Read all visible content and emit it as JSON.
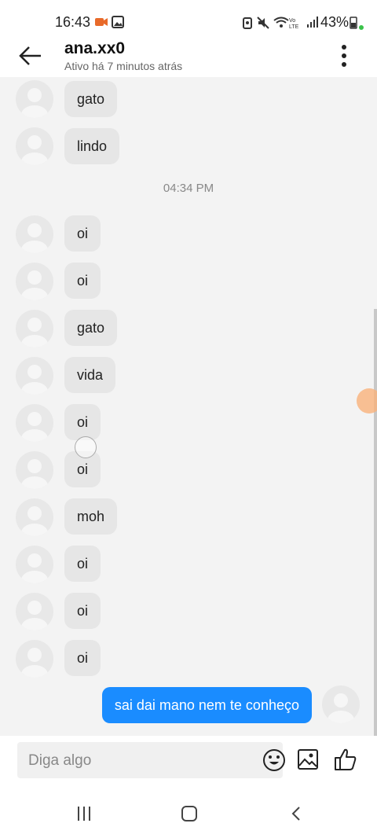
{
  "status": {
    "time": "16:43",
    "battery": "43%"
  },
  "header": {
    "title": "ana.xx0",
    "subtitle": "Ativo há 7 minutos atrás"
  },
  "timestamp": "04:34 PM",
  "messages": [
    "gato",
    "lindo",
    "oi",
    "oi",
    "gato",
    "vida",
    "oi",
    "oi",
    "moh",
    "oi",
    "oi",
    "oi"
  ],
  "sent": "sai dai mano nem te conheço",
  "input": {
    "placeholder": "Diga algo"
  },
  "icons": [
    "back-arrow-icon",
    "more-vert-icon",
    "emoji-icon",
    "image-icon",
    "thumbs-up-icon",
    "recent-apps-icon",
    "home-icon",
    "nav-back-icon"
  ],
  "colors": {
    "sent_bubble": "#1a8cff",
    "received_bubble": "#e6e6e6",
    "chat_background": "#f3f3f3"
  }
}
